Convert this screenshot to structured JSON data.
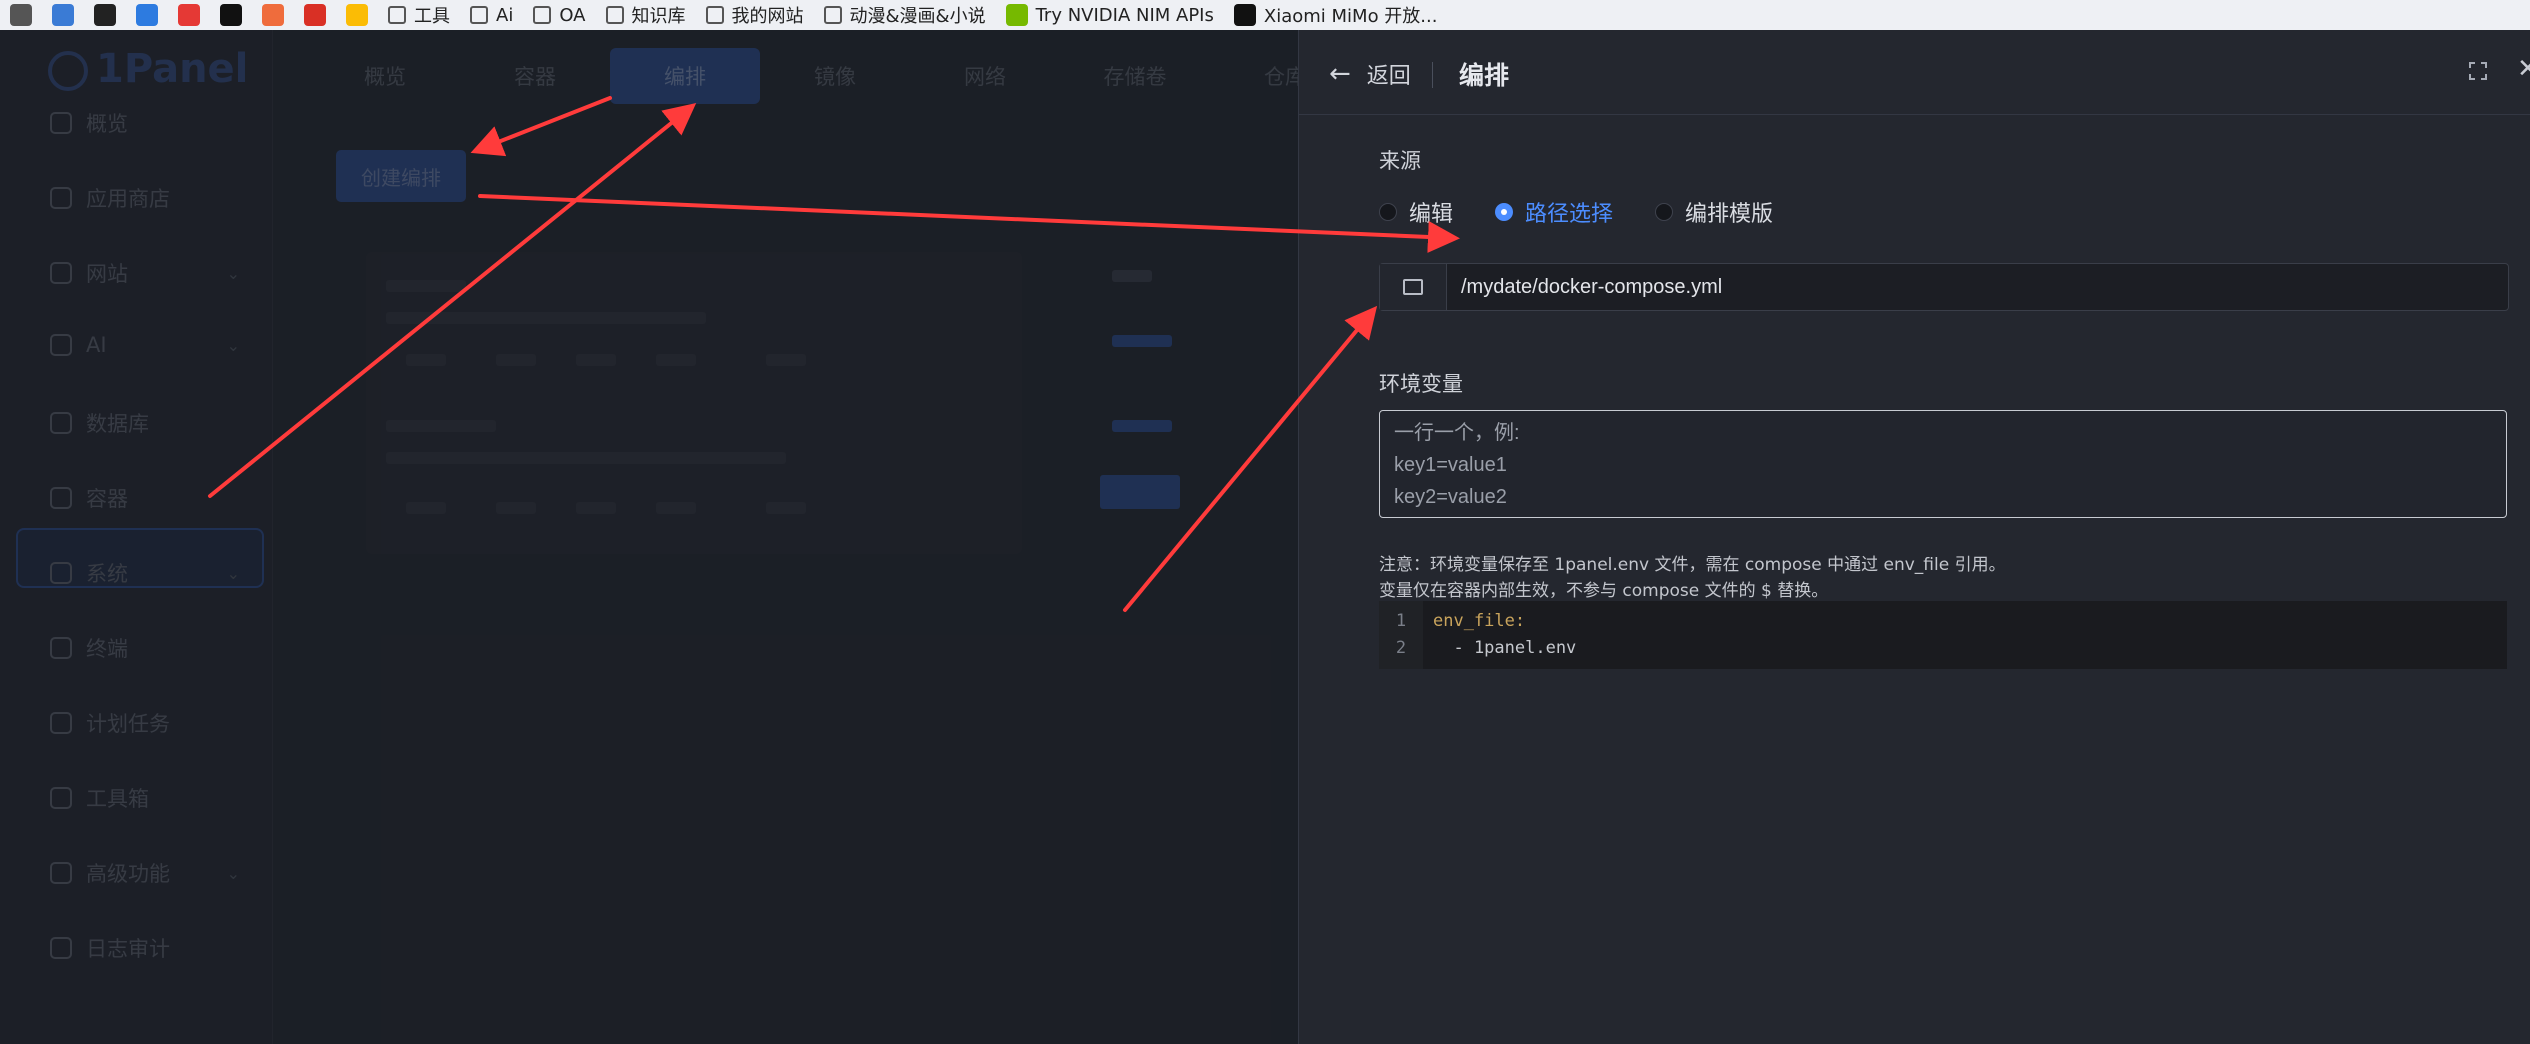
{
  "bookmarks": [
    {
      "label": "",
      "color": "#555555"
    },
    {
      "label": "",
      "color": "#3a7bd5"
    },
    {
      "label": "",
      "color": "#222222"
    },
    {
      "label": "",
      "color": "#2d7be0"
    },
    {
      "label": "",
      "color": "#e53935"
    },
    {
      "label": "",
      "color": "#111111"
    },
    {
      "label": "",
      "color": "#ef6c3c"
    },
    {
      "label": "",
      "color": "#d93025"
    },
    {
      "label": "",
      "color": "#fbbc05"
    },
    {
      "label": "工具",
      "folder": true
    },
    {
      "label": "Ai",
      "folder": true
    },
    {
      "label": "OA",
      "folder": true
    },
    {
      "label": "知识库",
      "folder": true
    },
    {
      "label": "我的网站",
      "folder": true
    },
    {
      "label": "动漫&漫画&小说",
      "folder": true
    },
    {
      "label": "Try NVIDIA NIM APIs",
      "color": "#76b900"
    },
    {
      "label": "Xiaomi MiMo 开放...",
      "color": "#111111"
    }
  ],
  "app": {
    "logo": "1Panel",
    "sidebar": [
      {
        "label": "概览",
        "chevron": ""
      },
      {
        "label": "应用商店",
        "chevron": ""
      },
      {
        "label": "网站",
        "chevron": "⌄"
      },
      {
        "label": "AI",
        "chevron": "⌄"
      },
      {
        "label": "数据库",
        "chevron": ""
      },
      {
        "label": "容器",
        "chevron": ""
      },
      {
        "label": "系统",
        "chevron": "⌄"
      },
      {
        "label": "终端",
        "chevron": ""
      },
      {
        "label": "计划任务",
        "chevron": ""
      },
      {
        "label": "工具箱",
        "chevron": ""
      },
      {
        "label": "高级功能",
        "chevron": "⌄"
      },
      {
        "label": "日志审计",
        "chevron": ""
      }
    ],
    "tabs": [
      "概览",
      "容器",
      "编排",
      "镜像",
      "网络",
      "存储卷",
      "仓库"
    ],
    "active_tab": "编排",
    "create_button": "创建编排"
  },
  "drawer": {
    "back_label": "返回",
    "title": "编排",
    "source_label": "来源",
    "source_options": [
      {
        "label": "编辑",
        "checked": false
      },
      {
        "label": "路径选择",
        "checked": true
      },
      {
        "label": "编排模版",
        "checked": false
      }
    ],
    "path_value": "/mydate/docker-compose.yml",
    "env_label": "环境变量",
    "env_placeholder": "一行一个，例:\nkey1=value1\nkey2=value2",
    "note_line1": "注意：环境变量保存至 1panel.env 文件，需在 compose 中通过 env_file 引用。",
    "note_line2": "变量仅在容器内部生效，不参与 compose 文件的 $ 替换。",
    "code_lines": [
      {
        "num": "1",
        "key": "env_file:",
        "val": ""
      },
      {
        "num": "2",
        "key": "",
        "val": "  - 1panel.env"
      }
    ]
  },
  "colors": {
    "accent": "#4c8dff",
    "annotation_arrow": "#ff3b3b",
    "drawer_bg": "#24272f"
  }
}
